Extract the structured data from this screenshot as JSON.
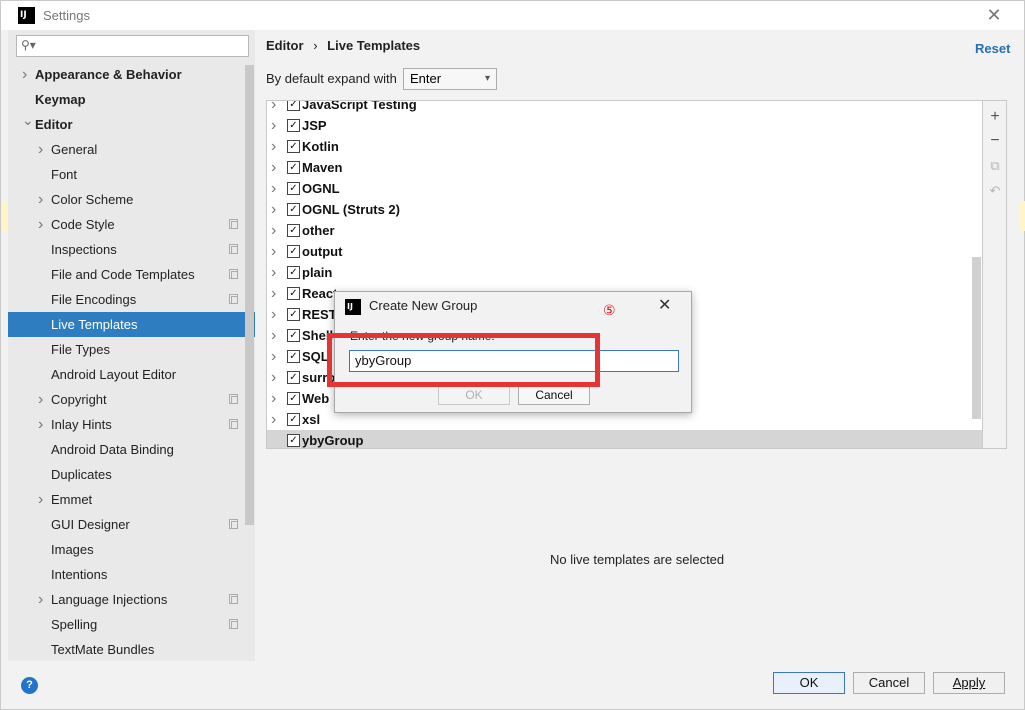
{
  "window": {
    "title": "Settings",
    "app_icon": "IJ"
  },
  "search": {
    "placeholder": ""
  },
  "tree": [
    {
      "label": "Appearance & Behavior",
      "bold": true,
      "chevron": "right",
      "indent": 0
    },
    {
      "label": "Keymap",
      "bold": true,
      "chevron": "",
      "indent": 0
    },
    {
      "label": "Editor",
      "bold": true,
      "chevron": "down",
      "indent": 0
    },
    {
      "label": "General",
      "bold": false,
      "chevron": "right",
      "indent": 1
    },
    {
      "label": "Font",
      "bold": false,
      "chevron": "",
      "indent": 1
    },
    {
      "label": "Color Scheme",
      "bold": false,
      "chevron": "right",
      "indent": 1
    },
    {
      "label": "Code Style",
      "bold": false,
      "chevron": "right",
      "indent": 1,
      "copy": true
    },
    {
      "label": "Inspections",
      "bold": false,
      "chevron": "",
      "indent": 1,
      "copy": true
    },
    {
      "label": "File and Code Templates",
      "bold": false,
      "chevron": "",
      "indent": 1,
      "copy": true
    },
    {
      "label": "File Encodings",
      "bold": false,
      "chevron": "",
      "indent": 1,
      "copy": true
    },
    {
      "label": "Live Templates",
      "bold": false,
      "chevron": "",
      "indent": 1,
      "selected": true
    },
    {
      "label": "File Types",
      "bold": false,
      "chevron": "",
      "indent": 1
    },
    {
      "label": "Android Layout Editor",
      "bold": false,
      "chevron": "",
      "indent": 1
    },
    {
      "label": "Copyright",
      "bold": false,
      "chevron": "right",
      "indent": 1,
      "copy": true
    },
    {
      "label": "Inlay Hints",
      "bold": false,
      "chevron": "right",
      "indent": 1,
      "copy": true
    },
    {
      "label": "Android Data Binding",
      "bold": false,
      "chevron": "",
      "indent": 1
    },
    {
      "label": "Duplicates",
      "bold": false,
      "chevron": "",
      "indent": 1
    },
    {
      "label": "Emmet",
      "bold": false,
      "chevron": "right",
      "indent": 1
    },
    {
      "label": "GUI Designer",
      "bold": false,
      "chevron": "",
      "indent": 1,
      "copy": true
    },
    {
      "label": "Images",
      "bold": false,
      "chevron": "",
      "indent": 1
    },
    {
      "label": "Intentions",
      "bold": false,
      "chevron": "",
      "indent": 1
    },
    {
      "label": "Language Injections",
      "bold": false,
      "chevron": "right",
      "indent": 1,
      "copy": true
    },
    {
      "label": "Spelling",
      "bold": false,
      "chevron": "",
      "indent": 1,
      "copy": true
    },
    {
      "label": "TextMate Bundles",
      "bold": false,
      "chevron": "",
      "indent": 1
    }
  ],
  "header": {
    "breadcrumb_parent": "Editor",
    "breadcrumb_sep": "›",
    "breadcrumb_current": "Live Templates",
    "reset": "Reset"
  },
  "expand": {
    "label": "By default expand with",
    "value": "Enter"
  },
  "template_groups": [
    {
      "name": "JavaScript Testing",
      "checked": true
    },
    {
      "name": "JSP",
      "checked": true
    },
    {
      "name": "Kotlin",
      "checked": true
    },
    {
      "name": "Maven",
      "checked": true
    },
    {
      "name": "OGNL",
      "checked": true
    },
    {
      "name": "OGNL (Struts 2)",
      "checked": true
    },
    {
      "name": "other",
      "checked": true
    },
    {
      "name": "output",
      "checked": true
    },
    {
      "name": "plain",
      "checked": true
    },
    {
      "name": "React",
      "checked": true
    },
    {
      "name": "RESTf",
      "checked": true
    },
    {
      "name": "Shell",
      "checked": true
    },
    {
      "name": "SQL",
      "checked": true
    },
    {
      "name": "surro",
      "checked": true
    },
    {
      "name": "Web",
      "checked": true
    },
    {
      "name": "xsl",
      "checked": true
    },
    {
      "name": "ybyGroup",
      "checked": true,
      "selected": true,
      "no_chevron": true
    }
  ],
  "tools": {
    "add": "+",
    "remove": "−",
    "copy": "⧉",
    "restore": "↶"
  },
  "empty_message": "No live templates are selected",
  "dialog": {
    "title": "Create New Group",
    "step_marker": "⑤",
    "prompt": "Enter the new group name:",
    "input_value": "ybyGroup",
    "ok": "OK",
    "cancel": "Cancel"
  },
  "footer": {
    "help": "?",
    "ok": "OK",
    "cancel": "Cancel",
    "apply": "Apply"
  },
  "colors": {
    "accent": "#2f7dc1",
    "highlight": "#e63333",
    "link": "#2470b3"
  }
}
